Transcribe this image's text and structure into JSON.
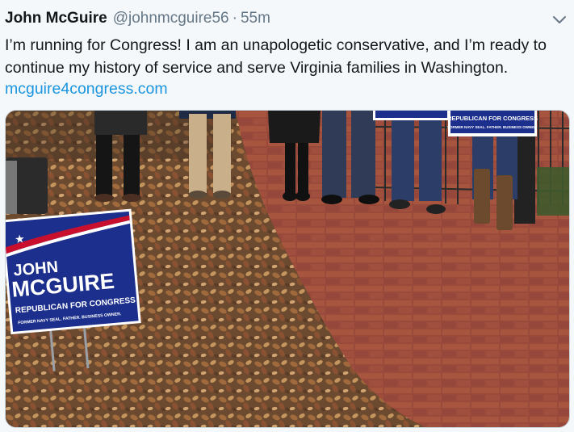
{
  "tweet": {
    "author_name": "John McGuire",
    "handle": "@johnmcguire56",
    "separator": "·",
    "time": "55m",
    "text": "I’m running for Congress! I am an unapologetic conservative, and I’m ready to continue my history of service and serve Virginia families in Washington.",
    "link": "mcguire4congress.com",
    "menu_icon": "chevron-down-icon"
  },
  "photo": {
    "sign_front": {
      "line1": "JOHN",
      "line2": "MCGUIRE",
      "line3": "REPUBLICAN FOR CONGRESS",
      "tagline": "FORMER NAVY SEAL. FATHER. BUSINESS OWNER."
    },
    "sign_back": {
      "line1": "REPUBLICAN FOR CONGRESS",
      "tagline": "FORMER NAVY SEAL. FATHER. BUSINESS OWNER."
    }
  },
  "colors": {
    "link": "#1b95e0",
    "secondary_text": "#657786",
    "sign_blue": "#1c2f8c",
    "sign_red": "#c8102e",
    "brick": "#9a4a3a"
  }
}
